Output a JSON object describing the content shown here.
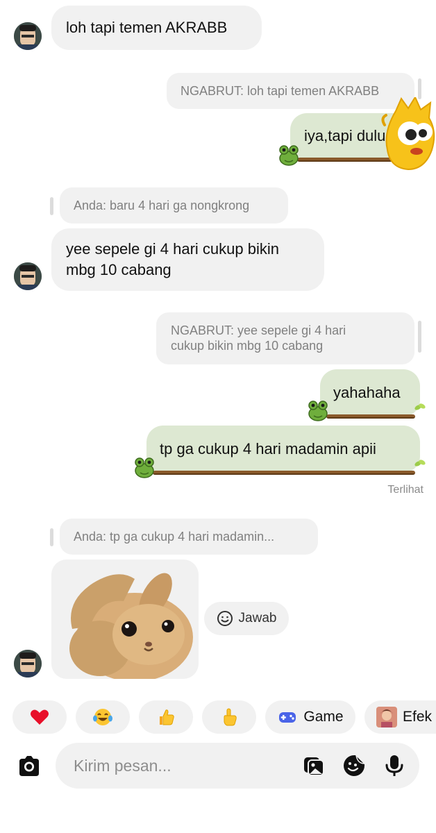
{
  "messages": {
    "m1": {
      "text": "loh tapi temen AKRABB"
    },
    "r1": {
      "text": "NGABRUT: loh tapi temen AKRABB"
    },
    "m2": {
      "text": "iya,tapi dulu"
    },
    "r2": {
      "text": "Anda: baru 4 hari ga nongkrong"
    },
    "m3": {
      "line1": "yee sepele gi 4 hari cukup bikin",
      "line2": "mbg 10 cabang"
    },
    "r3": {
      "line1": "NGABRUT: yee sepele gi 4 hari",
      "line2": "cukup bikin mbg 10 cabang"
    },
    "m4": {
      "text": "yahahaha"
    },
    "m5": {
      "text": "tp ga cukup 4 hari madamin apii"
    },
    "seen": "Terlihat",
    "r4": {
      "text": "Anda: tp ga cukup 4 hari madamin..."
    },
    "sticker": {
      "icon": "crying-bunny-sticker"
    }
  },
  "reply_button": {
    "label": "Jawab"
  },
  "quick_reactions": [
    {
      "icon": "red-heart-icon"
    },
    {
      "icon": "tears-of-joy-icon"
    },
    {
      "icon": "thumbs-up-icon"
    },
    {
      "icon": "pointing-hand-icon"
    },
    {
      "icon": "gamepad-icon",
      "label": "Game"
    },
    {
      "icon": "effect-thumbnail-icon",
      "label": "Efek"
    }
  ],
  "composer": {
    "placeholder": "Kirim pesan..."
  },
  "colors": {
    "incoming_bubble": "#f1f1f1",
    "outgoing_bubble": "#dde8d2",
    "vine": "#8a5a2b",
    "frog": "#6fae3c",
    "heart": "#e8102a",
    "gamepad": "#4a64e8"
  }
}
